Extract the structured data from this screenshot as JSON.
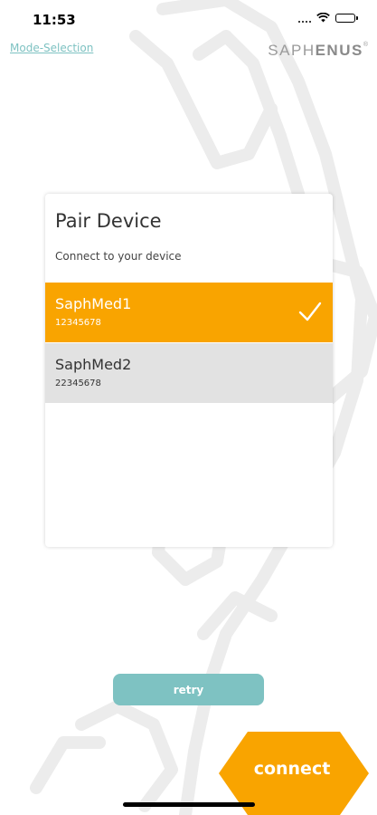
{
  "status_bar": {
    "time": "11:53"
  },
  "header": {
    "mode_link": "Mode-Selection",
    "brand_light": "SAPH",
    "brand_bold": "ENUS",
    "brand_mark": "®"
  },
  "card": {
    "title": "Pair Device",
    "subtitle": "Connect to your device",
    "devices": [
      {
        "name": "SaphMed1",
        "id": "12345678",
        "selected": true
      },
      {
        "name": "SaphMed2",
        "id": "22345678",
        "selected": false
      }
    ]
  },
  "actions": {
    "retry_label": "retry",
    "connect_label": "connect"
  },
  "colors": {
    "accent": "#f9a400",
    "teal": "#7ec2c2",
    "list_bg": "#e2e2e2"
  },
  "icons": {
    "selected_indicator": "check-icon"
  }
}
